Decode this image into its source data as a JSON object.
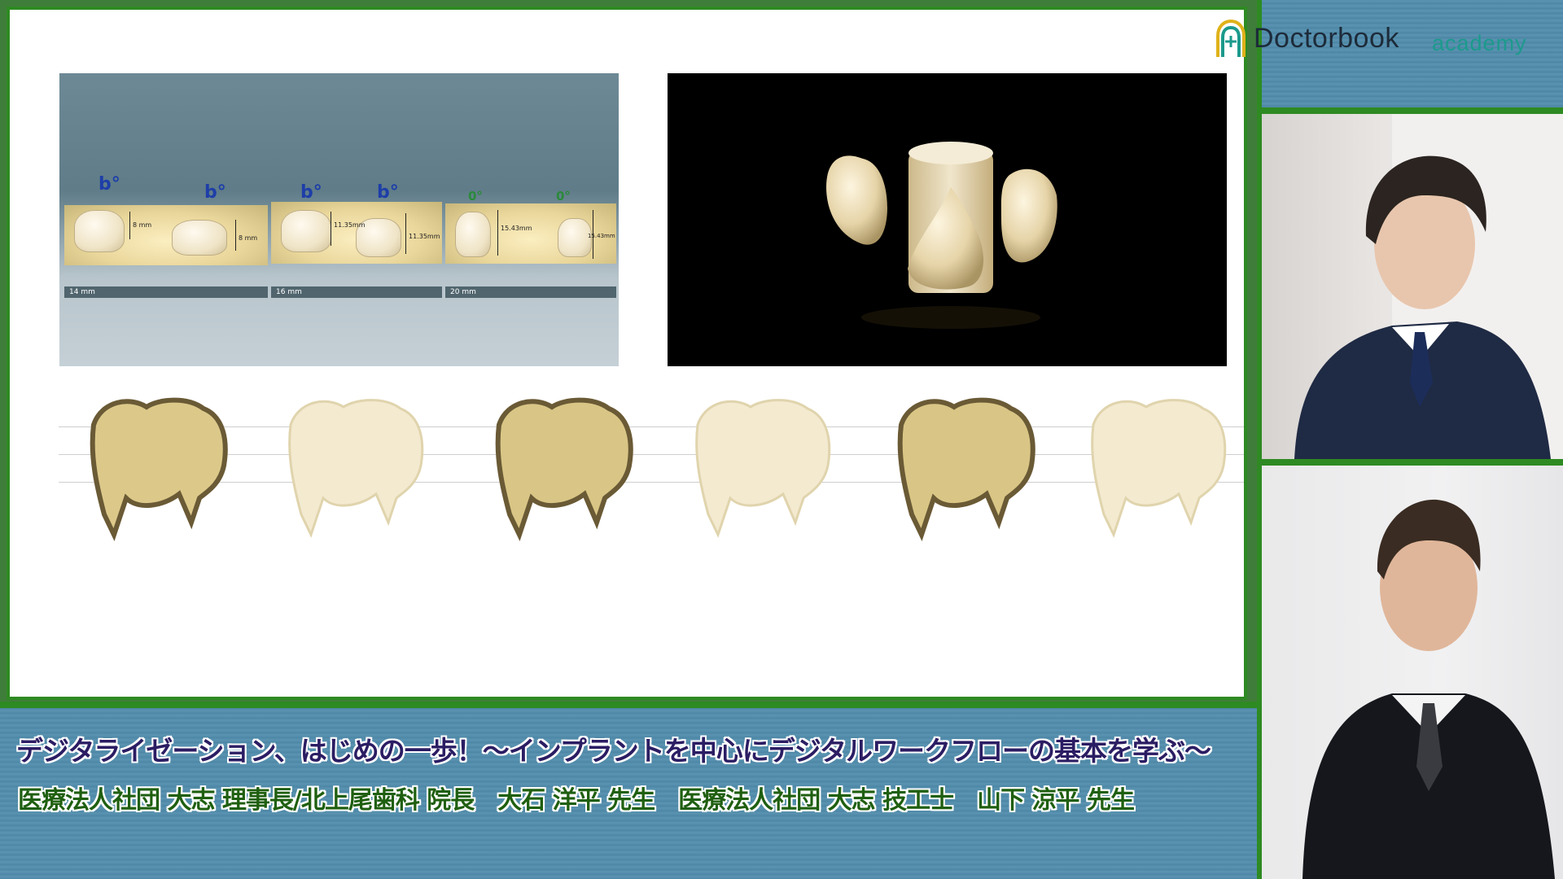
{
  "brand": {
    "name": "Doctorbook",
    "sub": "academy",
    "icon": "doctorbook-logo-icon"
  },
  "slide": {
    "diagram": {
      "angle_labels": [
        "b°",
        "b°",
        "b°",
        "b°",
        "0°",
        "0°"
      ],
      "measurements": [
        "8 mm",
        "8 mm",
        "11.35mm",
        "11.35mm",
        "15.43mm",
        "15.43mm"
      ],
      "scales": [
        "14 mm",
        "16 mm",
        "20 mm"
      ]
    },
    "photo": {
      "description_icon": "crown-on-cylinder-photo"
    },
    "teeth_row": {
      "count": 6
    }
  },
  "caption": {
    "title": "デジタライゼーション、はじめの一歩！～インプラントを中心にデジタルワークフローの基本を学ぶ～",
    "speakers": "医療法人社団 大志 理事長/北上尾歯科 院長　大石 洋平 先生　医療法人社団 大志 技工士　山下 涼平 先生"
  },
  "colors": {
    "frame_green": "#2e8a22",
    "caption_blue": "#5b94b2",
    "title_purple": "#2b1d63",
    "speaker_green": "#1f5f10",
    "brand_teal": "#1c9a8c"
  }
}
